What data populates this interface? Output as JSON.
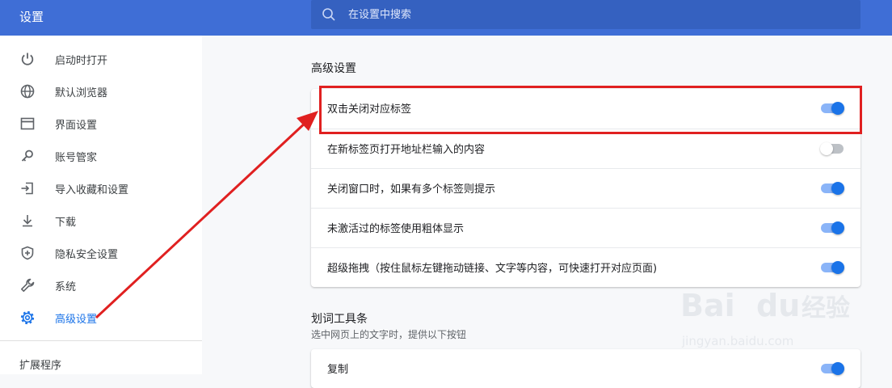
{
  "app": {
    "title": "设置"
  },
  "search": {
    "placeholder": "在设置中搜索"
  },
  "sidebar": {
    "items": [
      {
        "label": "启动时打开",
        "icon": "power-icon"
      },
      {
        "label": "默认浏览器",
        "icon": "globe-icon"
      },
      {
        "label": "界面设置",
        "icon": "browser-window-icon"
      },
      {
        "label": "账号管家",
        "icon": "key-icon"
      },
      {
        "label": "导入收藏和设置",
        "icon": "import-icon"
      },
      {
        "label": "下载",
        "icon": "download-icon"
      },
      {
        "label": "隐私安全设置",
        "icon": "shield-icon"
      },
      {
        "label": "系统",
        "icon": "wrench-icon"
      },
      {
        "label": "高级设置",
        "icon": "gear-icon",
        "active": true
      }
    ],
    "extensions_label": "扩展程序"
  },
  "advanced": {
    "title": "高级设置",
    "rows": [
      {
        "label": "双击关闭对应标签",
        "enabled": true
      },
      {
        "label": "在新标签页打开地址栏输入的内容",
        "enabled": false
      },
      {
        "label": "关闭窗口时，如果有多个标签则提示",
        "enabled": true
      },
      {
        "label": "未激活过的标签使用粗体显示",
        "enabled": true
      },
      {
        "label": "超级拖拽（按住鼠标左键拖动链接、文字等内容，可快速打开对应页面)",
        "enabled": true
      }
    ]
  },
  "toolbar_section": {
    "title": "划词工具条",
    "description": "选中网页上的文字时，提供以下按钮",
    "rows": [
      {
        "label": "复制",
        "enabled": true
      }
    ]
  },
  "watermark": {
    "brand": "Bai",
    "brand2": "du",
    "brand_cn": "经验",
    "url": "jingyan.baidu.com"
  },
  "colors": {
    "header": "#3f6ed6",
    "search": "#3561c0",
    "accent": "#1a73e8",
    "highlight": "#e02020"
  }
}
